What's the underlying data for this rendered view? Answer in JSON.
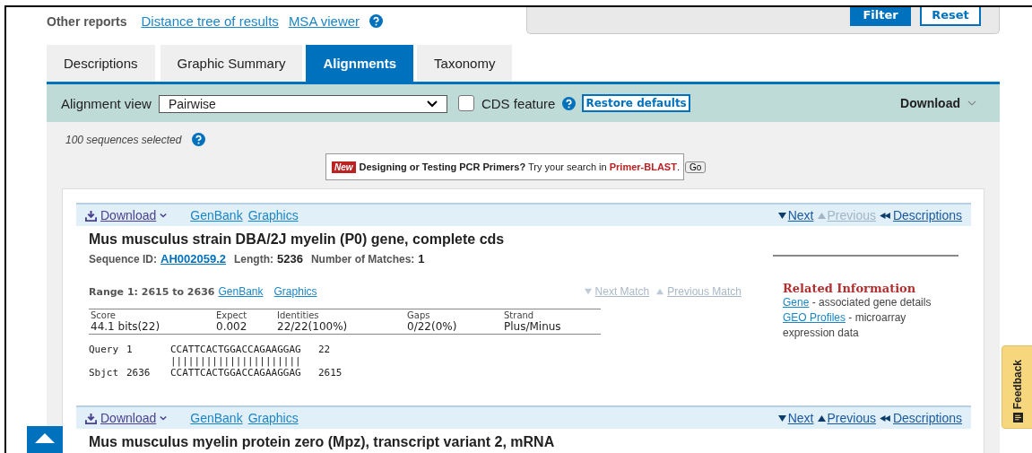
{
  "other_reports": {
    "label": "Other reports",
    "links": [
      "Distance tree of results",
      "MSA viewer"
    ]
  },
  "filter_panel": {
    "buttons": [
      {
        "label": "Filter",
        "primary": true
      },
      {
        "label": "Reset",
        "primary": false
      }
    ]
  },
  "tabs": [
    {
      "label": "Descriptions",
      "selected": false
    },
    {
      "label": "Graphic Summary",
      "selected": false
    },
    {
      "label": "Alignments",
      "selected": true
    },
    {
      "label": "Taxonomy",
      "selected": false
    }
  ],
  "toolbar": {
    "view_label": "Alignment view",
    "view_value": "Pairwise",
    "cds_label": "CDS feature",
    "cds_checked": false,
    "restore": "Restore defaults",
    "download": "Download"
  },
  "selected_count": "100 sequences selected",
  "promo": {
    "badge": "New",
    "text": "**Designing or Testing PCR Primers?** Try your search in ",
    "link": "Primer-BLAST",
    "after": ".",
    "button": "Go"
  },
  "alignments": [
    {
      "toolbar": {
        "download": "Download",
        "links": [
          "GenBank",
          "Graphics"
        ],
        "nav": [
          {
            "kind": "next",
            "label": "Next",
            "disabled": false
          },
          {
            "kind": "previous",
            "label": "Previous",
            "disabled": true
          },
          {
            "kind": "descriptions",
            "label": "Descriptions",
            "disabled": false
          }
        ]
      },
      "title": "Mus musculus strain DBA/2J myelin (P0) gene, complete cds",
      "meta": [
        {
          "label": "Sequence ID:",
          "value": "AH002059.2",
          "kind": "link"
        },
        {
          "label": "Length:",
          "value": "5236",
          "kind": "text"
        },
        {
          "label": "Number of Matches:",
          "value": "1",
          "kind": "text"
        }
      ],
      "range": {
        "label": "Range 1: 2615 to 2636",
        "links": [
          "GenBank",
          "Graphics"
        ],
        "next_match": "Next Match",
        "previous_match": "Previous Match"
      },
      "stats": [
        {
          "name": "Score",
          "value": "44.1 bits(22)"
        },
        {
          "name": "Expect",
          "value": "0.002"
        },
        {
          "name": "Identities",
          "value": "22/22(100%)"
        },
        {
          "name": "Gaps",
          "value": "0/22(0%)"
        },
        {
          "name": "Strand",
          "value": "Plus/Minus"
        }
      ],
      "lines": [
        {
          "label": "Query",
          "start": "1",
          "seq": "CCATTCACTGGACCAGAAGGAG",
          "end": "22"
        },
        {
          "seq": "||||||||||||||||||||||"
        },
        {
          "label": "Sbjct",
          "start": "2636",
          "seq": "CCATTCACTGGACCAGAAGGAG",
          "end": "2615"
        }
      ],
      "related": {
        "title": "Related Information",
        "items": [
          {
            "link": "Gene",
            "text": " - associated gene details"
          },
          {
            "link": "GEO Profiles",
            "text": " - microarray expression data"
          }
        ]
      }
    },
    {
      "toolbar": {
        "download": "Download",
        "links": [
          "GenBank",
          "Graphics"
        ],
        "nav": [
          {
            "kind": "next",
            "label": "Next",
            "disabled": false
          },
          {
            "kind": "previous",
            "label": "Previous",
            "disabled": false
          },
          {
            "kind": "descriptions",
            "label": "Descriptions",
            "disabled": false
          }
        ]
      },
      "title": "Mus musculus myelin protein zero (Mpz), transcript variant 2, mRNA"
    }
  ],
  "feedback": "Feedback"
}
